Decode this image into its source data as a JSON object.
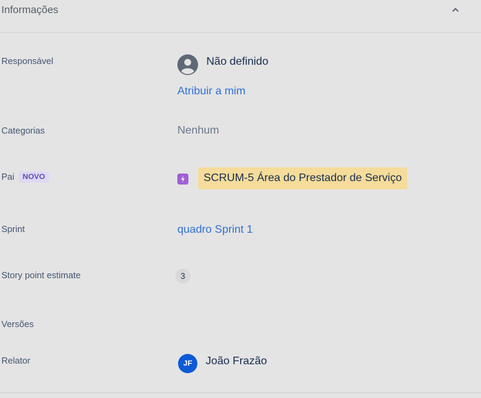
{
  "section": {
    "title": "Informações"
  },
  "fields": {
    "assignee": {
      "label": "Responsável",
      "value": "Não definido",
      "assign_to_me": "Atribuir a mim"
    },
    "categories": {
      "label": "Categorias",
      "value": "Nenhum"
    },
    "parent": {
      "label": "Pai",
      "badge": "NOVO",
      "value": "SCRUM-5 Área do Prestador de Serviço"
    },
    "sprint": {
      "label": "Sprint",
      "value": "quadro Sprint 1"
    },
    "story_points": {
      "label": "Story point estimate",
      "value": "3"
    },
    "versions": {
      "label": "Versões"
    },
    "reporter": {
      "label": "Relator",
      "initials": "JF",
      "value": "João Frazão"
    }
  },
  "colors": {
    "background": "#e4e4e4",
    "link": "#2f6fd6",
    "parent_highlight": "#f5dc9a",
    "epic_icon": "#9f5fd6",
    "reporter_avatar": "#0c5ad6",
    "lozenge_bg": "#dfd8f3",
    "lozenge_text": "#5e4db2"
  },
  "icons": {
    "collapse": "chevron-up-icon",
    "assignee_avatar": "default-user-avatar-icon",
    "parent_type": "epic-lightning-icon"
  }
}
